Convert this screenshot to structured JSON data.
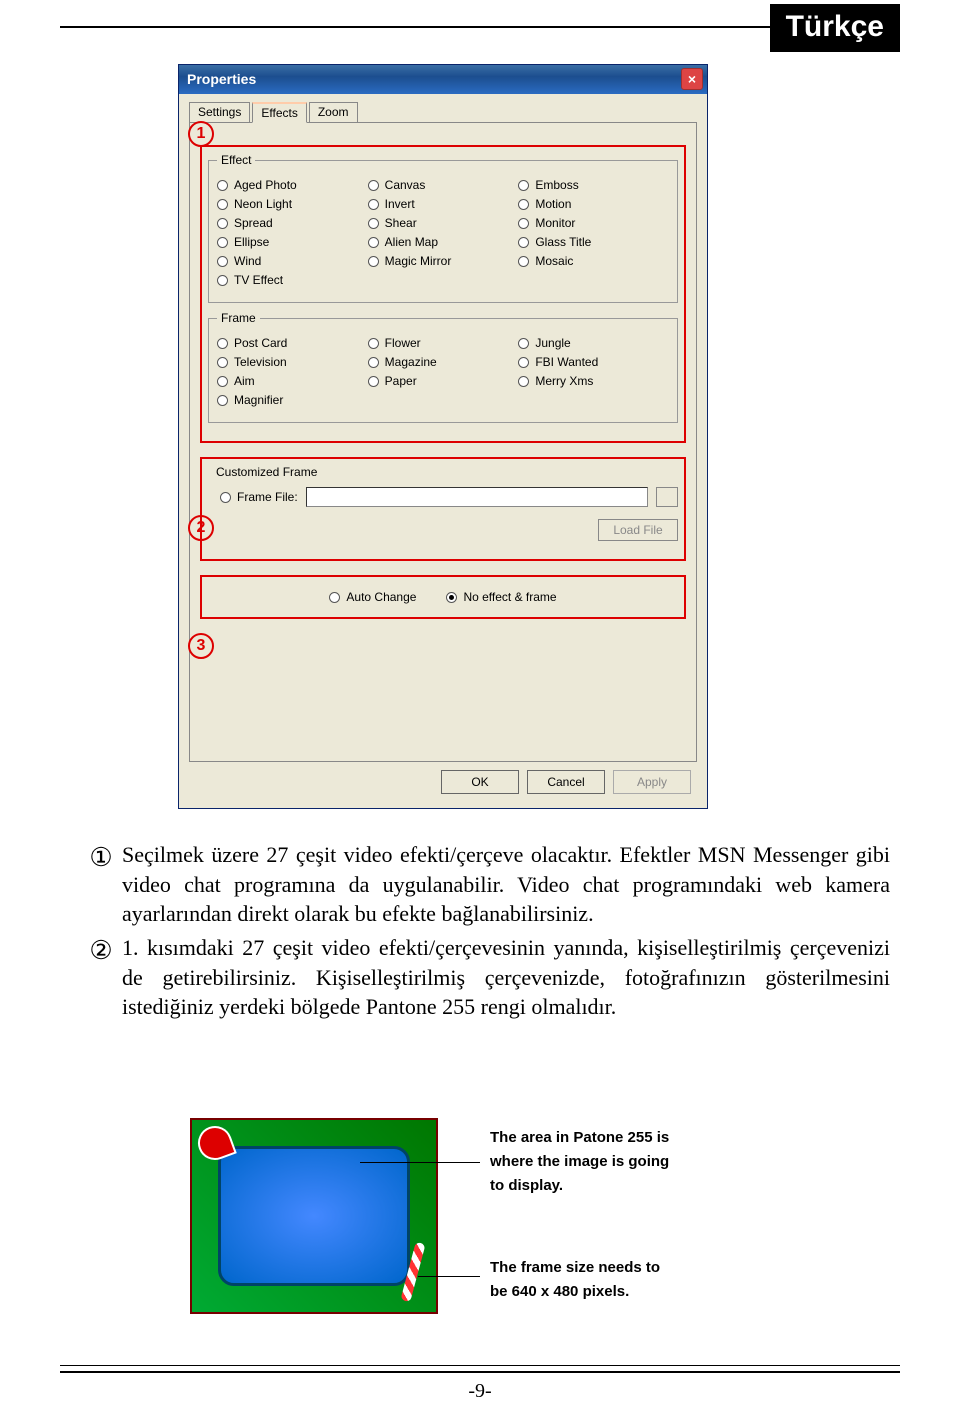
{
  "header": {
    "tag": "Türkçe"
  },
  "window": {
    "title": "Properties",
    "tabs": {
      "settings": "Settings",
      "effects": "Effects",
      "zoom": "Zoom"
    },
    "groups": {
      "effect": "Effect",
      "frame": "Frame",
      "customized": "Customized Frame"
    },
    "effects_col1": [
      "Aged Photo",
      "Neon Light",
      "Spread",
      "Ellipse",
      "Wind",
      "TV Effect"
    ],
    "effects_col2": [
      "Canvas",
      "Invert",
      "Shear",
      "Alien Map",
      "Magic Mirror"
    ],
    "effects_col3": [
      "Emboss",
      "Motion",
      "Monitor",
      "Glass Title",
      "Mosaic"
    ],
    "frames_col1": [
      "Post Card",
      "Television",
      "Aim",
      "Magnifier"
    ],
    "frames_col2": [
      "Flower",
      "Magazine",
      "Paper"
    ],
    "frames_col3": [
      "Jungle",
      "FBI Wanted",
      "Merry Xms"
    ],
    "frame_file_label": "Frame File:",
    "load_file": "Load File",
    "auto_change": "Auto Change",
    "no_effect": "No effect & frame",
    "buttons": {
      "ok": "OK",
      "cancel": "Cancel",
      "apply": "Apply"
    },
    "callouts": {
      "c1": "1",
      "c2": "2",
      "c3": "3"
    }
  },
  "body_text": {
    "p1": "Seçilmek üzere 27 çeşit video efekti/çerçeve olacaktır. Efektler MSN Messenger gibi video chat programına da uygulanabilir. Video chat programındaki web kamera ayarlarından direkt olarak bu efekte bağlanabilirsiniz.",
    "p2": "1. kısımdaki 27 çeşit video efekti/çerçevesinin yanında, kişiselleştirilmiş çerçevenizi de getirebilirsiniz. Kişiselleştirilmiş çerçevenizde, fotoğrafınızın gösterilmesini istediğiniz yerdeki bölgede Pantone 255 rengi olmalıdır.",
    "m1": "①",
    "m2": "②"
  },
  "illus": {
    "note1a": "The area in Patone 255 is",
    "note1b": "where the image is going",
    "note1c": "to display.",
    "note2a": "The frame size needs to",
    "note2b": "be 640 x 480 pixels."
  },
  "footer": {
    "page": "-9-"
  }
}
